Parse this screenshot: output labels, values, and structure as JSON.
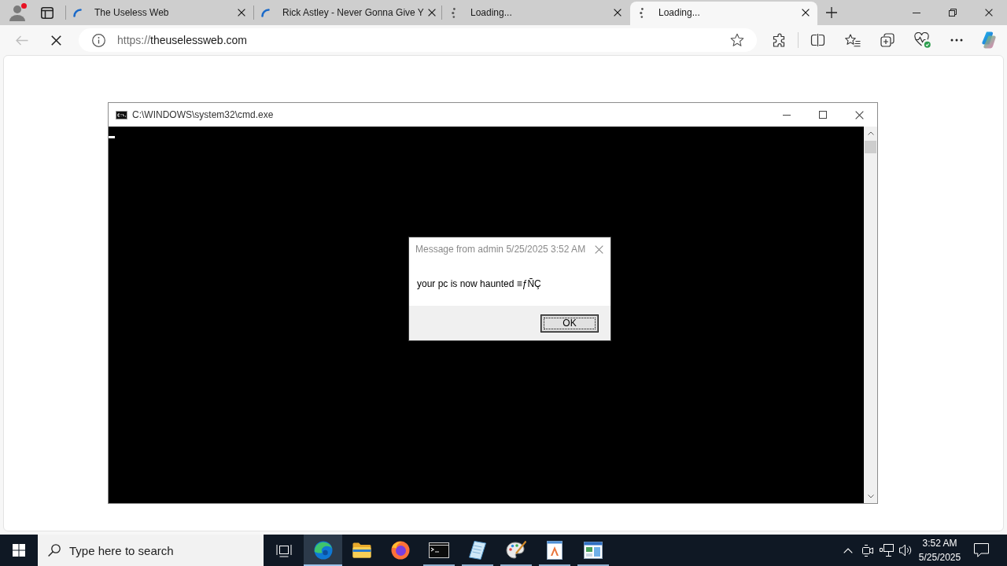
{
  "browser": {
    "profile": {
      "notification": true
    },
    "tabs": [
      {
        "title": "The Useless Web",
        "waiting": false,
        "selected": false
      },
      {
        "title": "Rick Astley - Never Gonna Give Y",
        "waiting": false,
        "selected": false
      },
      {
        "title": "Loading...",
        "waiting": true,
        "selected": false
      },
      {
        "title": "Loading...",
        "waiting": true,
        "selected": true
      }
    ],
    "nav": {
      "back_disabled": true,
      "loading": true
    },
    "address": {
      "scheme": "https://",
      "host": "theuselessweb.com"
    }
  },
  "console_window": {
    "title": "C:\\WINDOWS\\system32\\cmd.exe"
  },
  "message_box": {
    "title": "Message from admin 5/25/2025 3:52 AM",
    "message": "your pc is now haunted ≡ƒÑÇ",
    "buttons": [
      {
        "label": "OK",
        "focused": true
      }
    ]
  },
  "taskbar": {
    "search": {
      "placeholder": "Type here to search"
    },
    "apps": [
      {
        "kind": "swirl",
        "running": true,
        "selected": true
      },
      {
        "kind": "folder",
        "running": false,
        "selected": false
      },
      {
        "kind": "fox",
        "running": false,
        "selected": false
      },
      {
        "kind": "terminal",
        "running": true,
        "selected": false
      },
      {
        "kind": "notepad",
        "running": true,
        "selected": false
      },
      {
        "kind": "palette",
        "running": true,
        "selected": false
      },
      {
        "kind": "document",
        "running": true,
        "selected": false
      },
      {
        "kind": "window",
        "running": true,
        "selected": false
      }
    ],
    "clock": {
      "time": "3:52 AM",
      "date": "5/25/2025"
    }
  }
}
